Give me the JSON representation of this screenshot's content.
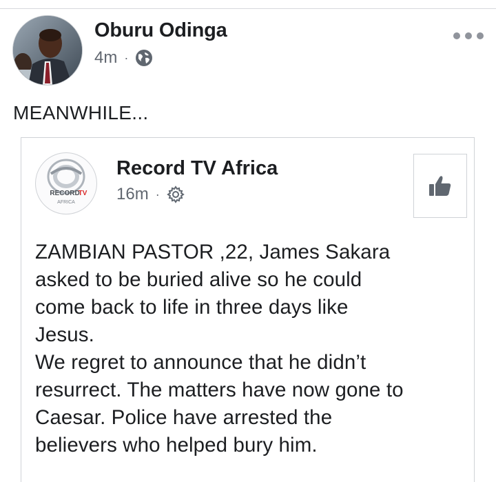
{
  "post": {
    "author": "Oburu Odinga",
    "time": "4m",
    "separator": "·",
    "privacy_icon": "globe-icon",
    "menu_icon": "more-options-icon",
    "status_text": "MEANWHILE..."
  },
  "shared": {
    "page_name": "Record TV Africa",
    "time": "16m",
    "separator": "·",
    "privacy_icon": "gear-icon",
    "logo_text_record": "RECORD",
    "logo_text_tv": "TV",
    "logo_text_africa": "AFRICA",
    "like_icon": "thumbs-up-icon",
    "lines": [
      "ZAMBIAN PASTOR ,22, James Sakara",
      "asked to be buried alive so he could",
      "come back to life in three days like",
      "Jesus.",
      "We regret to announce that he didn’t",
      "resurrect. The matters have now gone to",
      "Caesar. Police have arrested the",
      "believers who helped bury him."
    ]
  },
  "colors": {
    "text": "#1c1e21",
    "meta": "#616770",
    "border": "#cfd2d6",
    "icon_gray": "#606770",
    "logo_red": "#d92a2a"
  }
}
